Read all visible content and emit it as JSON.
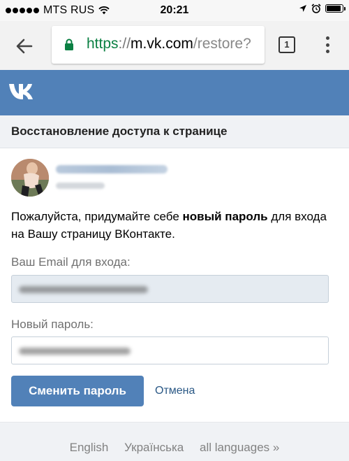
{
  "status_bar": {
    "carrier": "MTS RUS",
    "time": "20:21",
    "signal_icon": "signal-dots-icon",
    "wifi_icon": "wifi-icon",
    "location_icon": "location-arrow-icon",
    "alarm_icon": "alarm-icon",
    "battery_icon": "battery-icon",
    "battery_level": 0.9
  },
  "browser": {
    "url_scheme": "https",
    "url_separator": "://",
    "url_host": "m.vk.com",
    "url_path": "/restore?",
    "tab_count": "1",
    "back_icon": "back-arrow-icon",
    "lock_icon": "lock-icon",
    "menu_icon": "more-vert-icon"
  },
  "header": {
    "logo": "vk-logo",
    "brand_color": "#5181b8"
  },
  "page": {
    "title": "Восстановление доступа к странице",
    "intro_before": "Пожалуйста, придумайте себе ",
    "intro_bold": "новый пароль",
    "intro_after": " для входа на Вашу страницу ВКонтакте."
  },
  "form": {
    "email_label": "Ваш Email для входа:",
    "password_label": "Новый пароль:",
    "submit_label": "Сменить пароль",
    "cancel_label": "Отмена"
  },
  "footer": {
    "languages": [
      "English",
      "Українська",
      "all languages »"
    ]
  }
}
